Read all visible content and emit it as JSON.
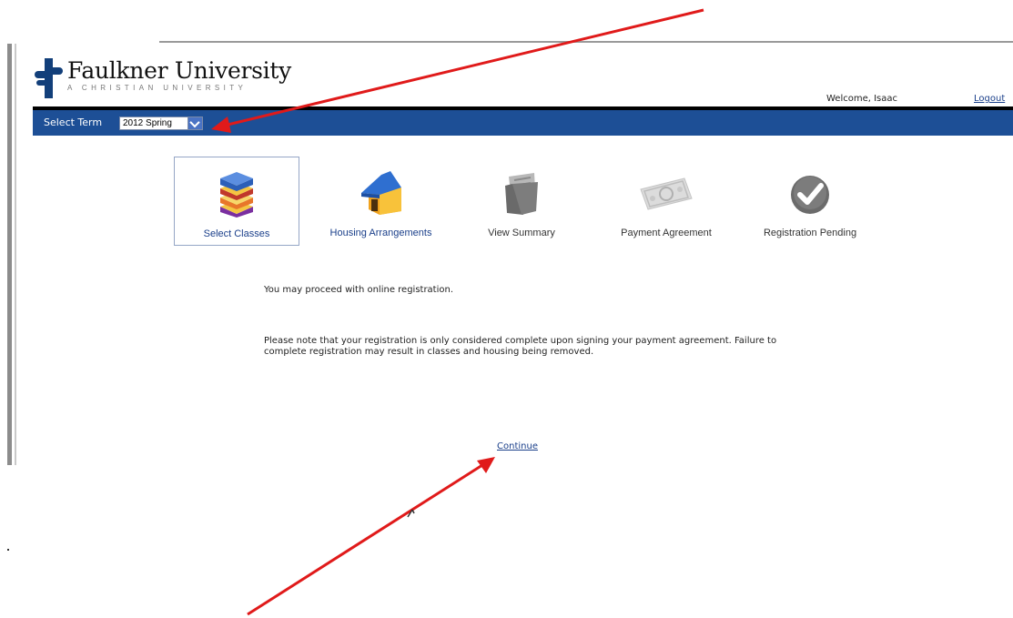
{
  "header": {
    "brand_name": "Faulkner University",
    "brand_tagline": "A CHRISTIAN UNIVERSITY",
    "welcome_text": "Welcome, Isaac",
    "logout_label": "Logout"
  },
  "term_bar": {
    "label": "Select Term",
    "selected_term": "2012 Spring"
  },
  "steps": [
    {
      "label": "Select Classes",
      "icon": "books-icon",
      "active": true
    },
    {
      "label": "Housing Arrangements",
      "icon": "house-icon",
      "active": false
    },
    {
      "label": "View Summary",
      "icon": "folder-icon",
      "active": false
    },
    {
      "label": "Payment Agreement",
      "icon": "money-icon",
      "active": false
    },
    {
      "label": "Registration Pending",
      "icon": "checkmark-icon",
      "active": false
    }
  ],
  "messages": {
    "proceed": "You may proceed with online registration.",
    "note": "Please note that your registration is only considered complete upon signing your payment agreement. Failure to complete registration may result in classes and housing being removed."
  },
  "continue_label": "Continue",
  "colors": {
    "nav_bar": "#1d4f96",
    "link": "#1a3f8a",
    "annotation_arrow": "#e01a1a"
  }
}
